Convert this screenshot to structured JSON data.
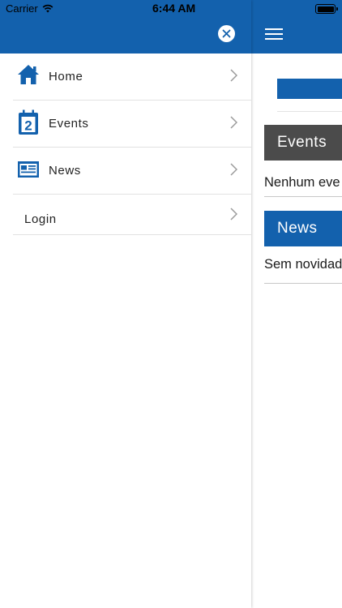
{
  "status_bar": {
    "carrier": "Carrier",
    "time": "6:44 AM"
  },
  "drawer": {
    "menu_items": [
      {
        "label": "Home",
        "icon": "home-icon"
      },
      {
        "label": "Events",
        "icon": "calendar-icon"
      },
      {
        "label": "News",
        "icon": "newspaper-icon"
      },
      {
        "label": "Login",
        "icon": ""
      }
    ]
  },
  "main": {
    "events_header": "Events",
    "events_text": "Nenhum eve",
    "news_header": "News",
    "news_text": "Sem novidad"
  },
  "colors": {
    "brand_blue": "#1361ad",
    "events_header_bg": "#4b4b4b"
  }
}
